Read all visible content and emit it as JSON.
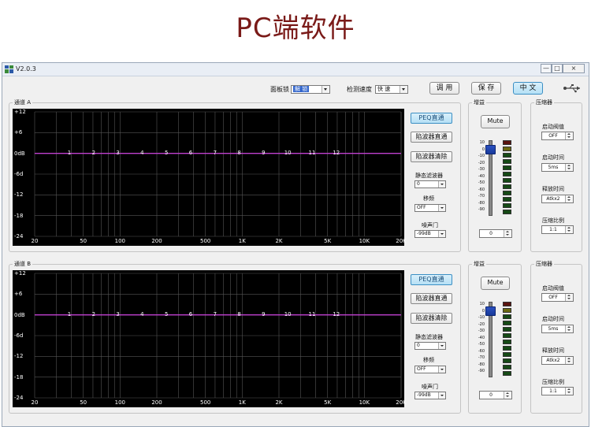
{
  "banner": {
    "title": "PC端软件"
  },
  "window": {
    "title": "V2.0.3",
    "controls": {
      "minimize": "—",
      "maximize": "□",
      "close": "×"
    }
  },
  "toolbar": {
    "panel_lock_label": "面板锁",
    "panel_lock_value": "解 锁",
    "detect_speed_label": "检测速度",
    "detect_speed_value": "快 速",
    "adjust_button": "调 用",
    "save_button": "保 存",
    "language_button": "中 文",
    "usb_icon": "usb-icon"
  },
  "channels": [
    {
      "label": "通道 A",
      "peq_bypass": "PEQ直通",
      "notch_bypass": "陷波器直通",
      "notch_clear": "陷波器清除",
      "static_filter_label": "静态滤波器",
      "static_filter_value": "0",
      "shift_label": "移频",
      "shift_value": "OFF",
      "noise_gate_label": "噪声门",
      "noise_gate_value": "-99dB",
      "gain_group": "增益",
      "mute_button": "Mute",
      "gain_value": "0",
      "comp_group": "压缩器",
      "threshold_label": "启动阀值",
      "threshold_value": "OFF",
      "attack_label": "启动时间",
      "attack_value": "5ms",
      "release_label": "释放时间",
      "release_value": "Atkx2",
      "ratio_label": "压缩比例",
      "ratio_value": "1:1"
    },
    {
      "label": "通道 B",
      "peq_bypass": "PEQ直通",
      "notch_bypass": "陷波器直通",
      "notch_clear": "陷波器清除",
      "static_filter_label": "静态滤波器",
      "static_filter_value": "0",
      "shift_label": "移频",
      "shift_value": "OFF",
      "noise_gate_label": "噪声门",
      "noise_gate_value": "-99dB",
      "gain_group": "增益",
      "mute_button": "Mute",
      "gain_value": "0",
      "comp_group": "压缩器",
      "threshold_label": "启动阀值",
      "threshold_value": "OFF",
      "attack_label": "启动时间",
      "attack_value": "5ms",
      "release_label": "释放时间",
      "release_value": "Atkx2",
      "ratio_label": "压缩比例",
      "ratio_value": "1:1"
    }
  ],
  "eq_graph": {
    "y_ticks": [
      "+12",
      "+6",
      "0dB",
      "-6d",
      "-12",
      "-18",
      "-24"
    ],
    "x_ticks": [
      "20",
      "50",
      "100",
      "200",
      "500",
      "1K",
      "2K",
      "5K",
      "10K",
      "20K"
    ],
    "bands": [
      "1",
      "2",
      "3",
      "4",
      "5",
      "6",
      "7",
      "8",
      "9",
      "10",
      "11",
      "12"
    ]
  },
  "meter": {
    "scale": [
      "10",
      "0",
      "-10",
      "-20",
      "-30",
      "-40",
      "-50",
      "-60",
      "-70",
      "-80",
      "-90"
    ],
    "led_colors": [
      "#5a1410",
      "#6b6a12",
      "#164a16",
      "#164a16",
      "#164a16",
      "#164a16",
      "#164a16",
      "#164a16",
      "#164a16",
      "#164a16",
      "#164a16",
      "#164a16"
    ]
  },
  "colors": {
    "curve": "#c040d0",
    "banner_title": "#7a1a18",
    "active_button": "#b5e0f5"
  }
}
